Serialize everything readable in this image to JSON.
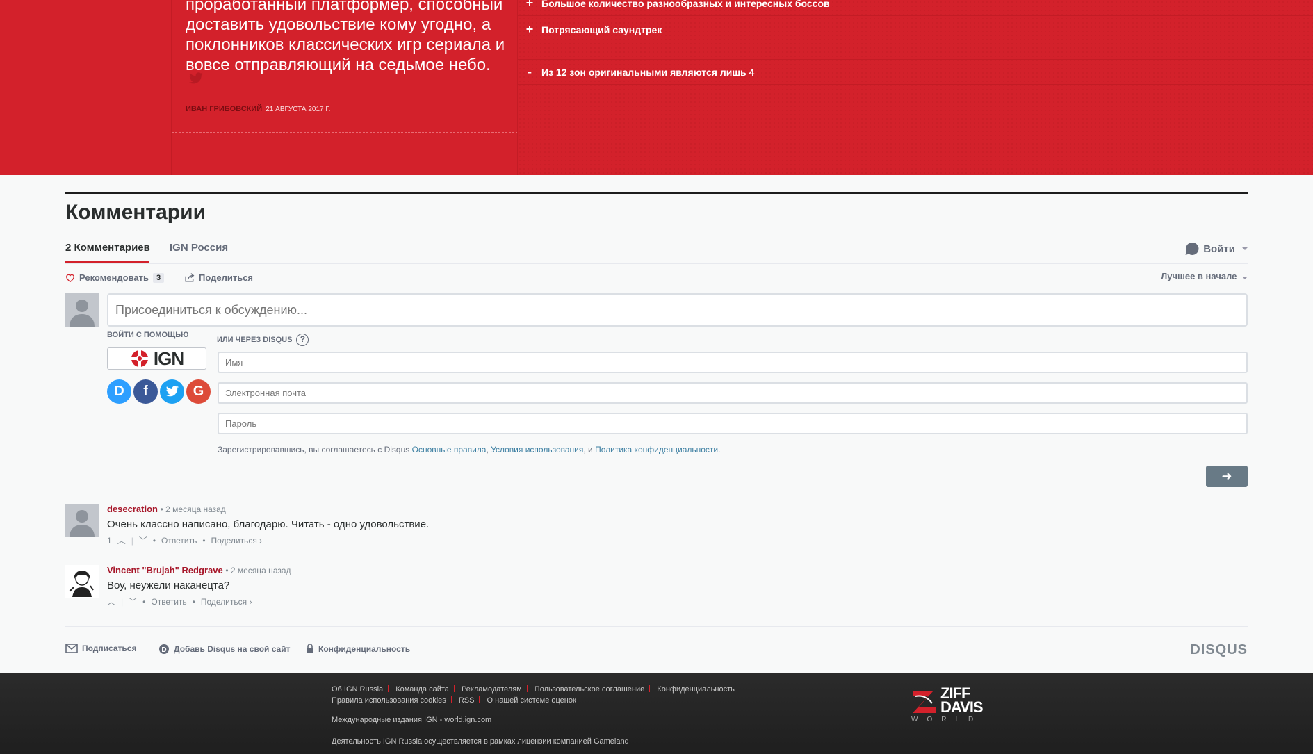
{
  "review": {
    "quote": "проработанный платформер, способный доставить удовольствие кому угодно, а поклонников классических игр сериала и вовсе отправляющий на седьмое небо.",
    "author": "Иван Грибовский",
    "date": "21 августа 2017 г.",
    "pros": [
      {
        "sign": "+",
        "text": "Большое количество разнообразных и интересных боссов"
      },
      {
        "sign": "+",
        "text": "Потрясающий саундтрек"
      }
    ],
    "cons": [
      {
        "sign": "-",
        "text": "Из 12 зон оригинальными являются лишь 4"
      }
    ]
  },
  "comments": {
    "heading": "Комментарии",
    "tabs": [
      "2 Комментариев",
      "IGN Россия"
    ],
    "login_label": "Войти",
    "recommend_label": "Рекомендовать",
    "recommend_count": "3",
    "share_label": "Поделиться",
    "sort_label": "Лучшее в начале",
    "composer_placeholder": "Присоединиться к обсуждению...",
    "login_with": "Войти с помощью",
    "ign_logo_text": "IGN",
    "or_disqus": "или через Disqus",
    "help_glyph": "?",
    "social": [
      {
        "glyph": "D",
        "name": "disqus",
        "color": "#2e9fff"
      },
      {
        "glyph": "f",
        "name": "facebook",
        "color": "#3b5998"
      },
      {
        "glyph": "t",
        "name": "twitter",
        "color": "#1da1f2"
      },
      {
        "glyph": "G",
        "name": "google",
        "color": "#dd4b39"
      }
    ],
    "fields": {
      "name_placeholder": "Имя",
      "email_placeholder": "Электронная почта",
      "password_placeholder": "Пароль"
    },
    "terms": {
      "prefix": "Зарегистрировавшись, вы соглашаетесь с Disqus",
      "link1": "Основные правила",
      "comma": ",",
      "link2": "Условия использования",
      "and": ", и",
      "link3": "Политика конфиденциальности",
      "dot": "."
    },
    "next_glyph": "➜",
    "items": [
      {
        "author": "desecration",
        "when": "2 месяца назад",
        "text": "Очень классно написано, благодарю. Читать - одно удовольствие.",
        "votes": "1",
        "reply": "Ответить",
        "share": "Поделиться ›"
      },
      {
        "author": "Vincent \"Brujah\" Redgrave",
        "when": "2 месяца назад",
        "text": "Воу, неужели наканецта?",
        "votes": "",
        "reply": "Ответить",
        "share": "Поделиться ›"
      }
    ],
    "footer": {
      "subscribe": "Подписаться",
      "add_disqus": "Добавь Disqus на свой сайт",
      "privacy": "Конфиденциальность",
      "brand": "DISQUS"
    }
  },
  "site_footer": {
    "links": [
      "Об IGN Russia",
      "Команда сайта",
      "Рекламодателям",
      "Пользовательское соглашение",
      "Конфиденциальность",
      "Правила использования cookies",
      "RSS",
      "О нашей системе оценок"
    ],
    "intl": "Международные издания IGN - world.ign.com",
    "license": "Деятельность IGN Russia осуществляется в рамках лицензии компанией Gameland",
    "brand_line1": "ZIFF",
    "brand_line2": "DAVIS",
    "brand_line3": "WORLD"
  },
  "colors": {
    "ign_red": "#d3212b",
    "author_red": "#a7172a",
    "link_blue": "#3b7ea1",
    "button_gray": "#687a86"
  }
}
